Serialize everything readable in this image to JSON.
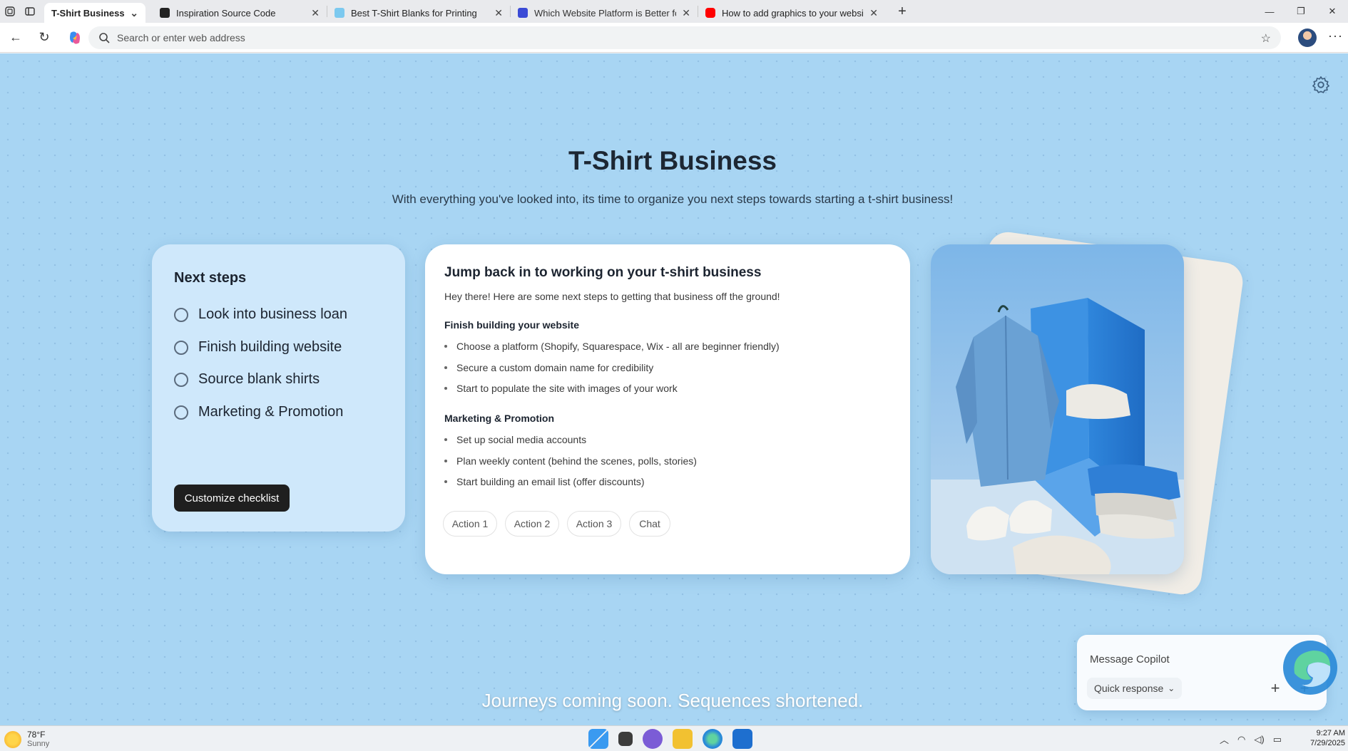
{
  "browser": {
    "tabs": [
      {
        "label": "T-Shirt Business",
        "active": true,
        "favicon_color": "#ffffff"
      },
      {
        "label": "Inspiration Source Code",
        "active": false,
        "favicon_color": "#222222"
      },
      {
        "label": "Best T-Shirt Blanks for Printing",
        "active": false,
        "favicon_color": "#7cc9ef"
      },
      {
        "label": "Which Website Platform is Better fo",
        "active": false,
        "favicon_color": "#3b4bd6"
      },
      {
        "label": "How to add graphics to your websi",
        "active": false,
        "favicon_color": "#ff0000"
      }
    ],
    "address": {
      "placeholder": "Search or enter web address"
    }
  },
  "page": {
    "title": "T-Shirt Business",
    "subtitle": "With everything you've looked into, its time to organize you next steps towards starting a t-shirt business!",
    "next_steps": {
      "heading": "Next steps",
      "items": [
        "Look into business loan",
        "Finish building website",
        "Source blank shirts",
        "Marketing & Promotion"
      ],
      "button": "Customize checklist"
    },
    "main_card": {
      "heading": "Jump back in to working on your t-shirt business",
      "intro": "Hey there! Here are some next steps to getting that business off the ground!",
      "sections": [
        {
          "title": "Finish building your website",
          "bullets": [
            "Choose a platform (Shopify, Squarespace, Wix - all are beginner friendly)",
            "Secure a custom domain name for credibility",
            "Start to populate the site with images of your work"
          ]
        },
        {
          "title": "Marketing & Promotion",
          "bullets": [
            "Set up social media accounts",
            "Plan weekly content (behind the scenes, polls, stories)",
            "Start building an email list (offer discounts)"
          ]
        }
      ],
      "actions": [
        "Action 1",
        "Action 2",
        "Action 3",
        "Chat"
      ]
    },
    "copilot": {
      "placeholder": "Message Copilot",
      "quick_response": "Quick response",
      "plus_symbol": "+"
    },
    "caption": "Journeys coming soon. Sequences shortened."
  },
  "taskbar": {
    "temperature": "78°F",
    "condition": "Sunny",
    "time": "9:27 AM",
    "date": "7/29/2025"
  },
  "colors": {
    "canvas": "#a8d5f3",
    "card_light": "#cfe8fb",
    "button_dark": "#1f1f1f"
  }
}
